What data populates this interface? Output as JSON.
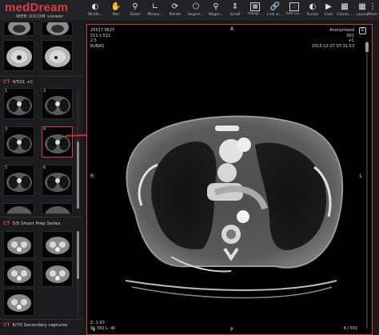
{
  "app": {
    "logo": "medDream",
    "logo_sub": "WEB DICOM viewer"
  },
  "toolbar": {
    "tools": [
      {
        "label": "Windo...",
        "icon": "window-level-icon"
      },
      {
        "label": "Pan",
        "icon": "pan-icon"
      },
      {
        "label": "Zoom",
        "icon": "zoom-icon"
      },
      {
        "label": "Measu...",
        "icon": "measure-icon"
      },
      {
        "label": "Rotate",
        "icon": "rotate-icon"
      },
      {
        "label": "Segme...",
        "icon": "segment-icon"
      },
      {
        "label": "Magni...",
        "icon": "magnifier-icon"
      },
      {
        "label": "Scroll",
        "icon": "scroll-icon"
      },
      {
        "label": "Hangi...",
        "icon": "hanging-protocol-icon"
      },
      {
        "label": "Link sc...",
        "icon": "link-scroll-icon"
      },
      {
        "label": "Info La...",
        "icon": "info-layer-icon"
      },
      {
        "label": "Fusion",
        "icon": "fusion-icon"
      },
      {
        "label": "Cine",
        "icon": "cine-icon"
      },
      {
        "label": "Chann...",
        "icon": "channel-icon"
      },
      {
        "label": "Layout",
        "icon": "layout-icon"
      },
      {
        "label": "More",
        "icon": "more-icon"
      }
    ]
  },
  "sidebar": {
    "series": [
      {
        "modality": "CT",
        "title": "4/501 +C"
      },
      {
        "modality": "CT",
        "title": "5/5 Smart Prep Series"
      },
      {
        "modality": "CT",
        "title": "6/70 Secondary captures"
      }
    ],
    "thumb_numbers": [
      "1",
      "2",
      "3",
      "4",
      "5",
      "6"
    ]
  },
  "viewer": {
    "top_left": [
      "20527 062Y",
      "512 x 512",
      "2.5",
      "KUNAS"
    ],
    "top_right": [
      "Anonymized",
      "001",
      "+C",
      "2015-12-07 07:31:53"
    ],
    "bottom_left": [
      "Z: 1.63",
      "W: 350 L: 40"
    ],
    "bottom_right": "4 / 501",
    "orientation": {
      "top": "A",
      "left": "R",
      "right": "L",
      "bottom": "P"
    },
    "slice_index": 4,
    "slice_count": 501
  },
  "colors": {
    "accent": "#d43a3a",
    "brand": "#e23a3a",
    "background": "#1a1a1c"
  }
}
